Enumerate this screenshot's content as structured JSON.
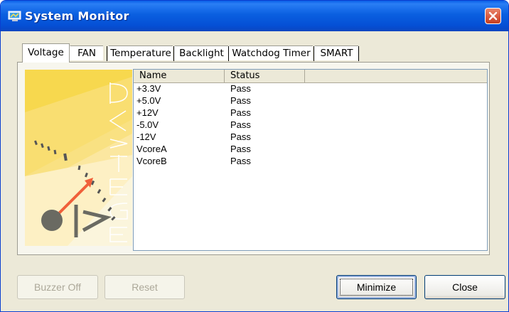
{
  "window": {
    "title": "System Monitor",
    "close_icon": "close-icon"
  },
  "tabs": [
    {
      "label": "Voltage",
      "active": true
    },
    {
      "label": "FAN",
      "active": false
    },
    {
      "label": "Temperature",
      "active": false
    },
    {
      "label": "Backlight",
      "active": false
    },
    {
      "label": "Watchdog Timer",
      "active": false
    },
    {
      "label": "SMART",
      "active": false
    }
  ],
  "panel": {
    "art_text": "VOLTAGE",
    "columns": [
      "Name",
      "Status"
    ],
    "rows": [
      {
        "name": "+3.3V",
        "status": "Pass"
      },
      {
        "name": "+5.0V",
        "status": "Pass"
      },
      {
        "name": "+12V",
        "status": "Pass"
      },
      {
        "name": "-5.0V",
        "status": "Pass"
      },
      {
        "name": "-12V",
        "status": "Pass"
      },
      {
        "name": "VcoreA",
        "status": "Pass"
      },
      {
        "name": "VcoreB",
        "status": "Pass"
      }
    ]
  },
  "buttons": {
    "buzzer_off": "Buzzer Off",
    "reset": "Reset",
    "minimize": "Minimize",
    "close": "Close"
  },
  "colors": {
    "titlebar": "#0a5fe0",
    "face": "#ece9d8",
    "art_yellow": "#f7d54a",
    "needle": "#f0603a"
  }
}
